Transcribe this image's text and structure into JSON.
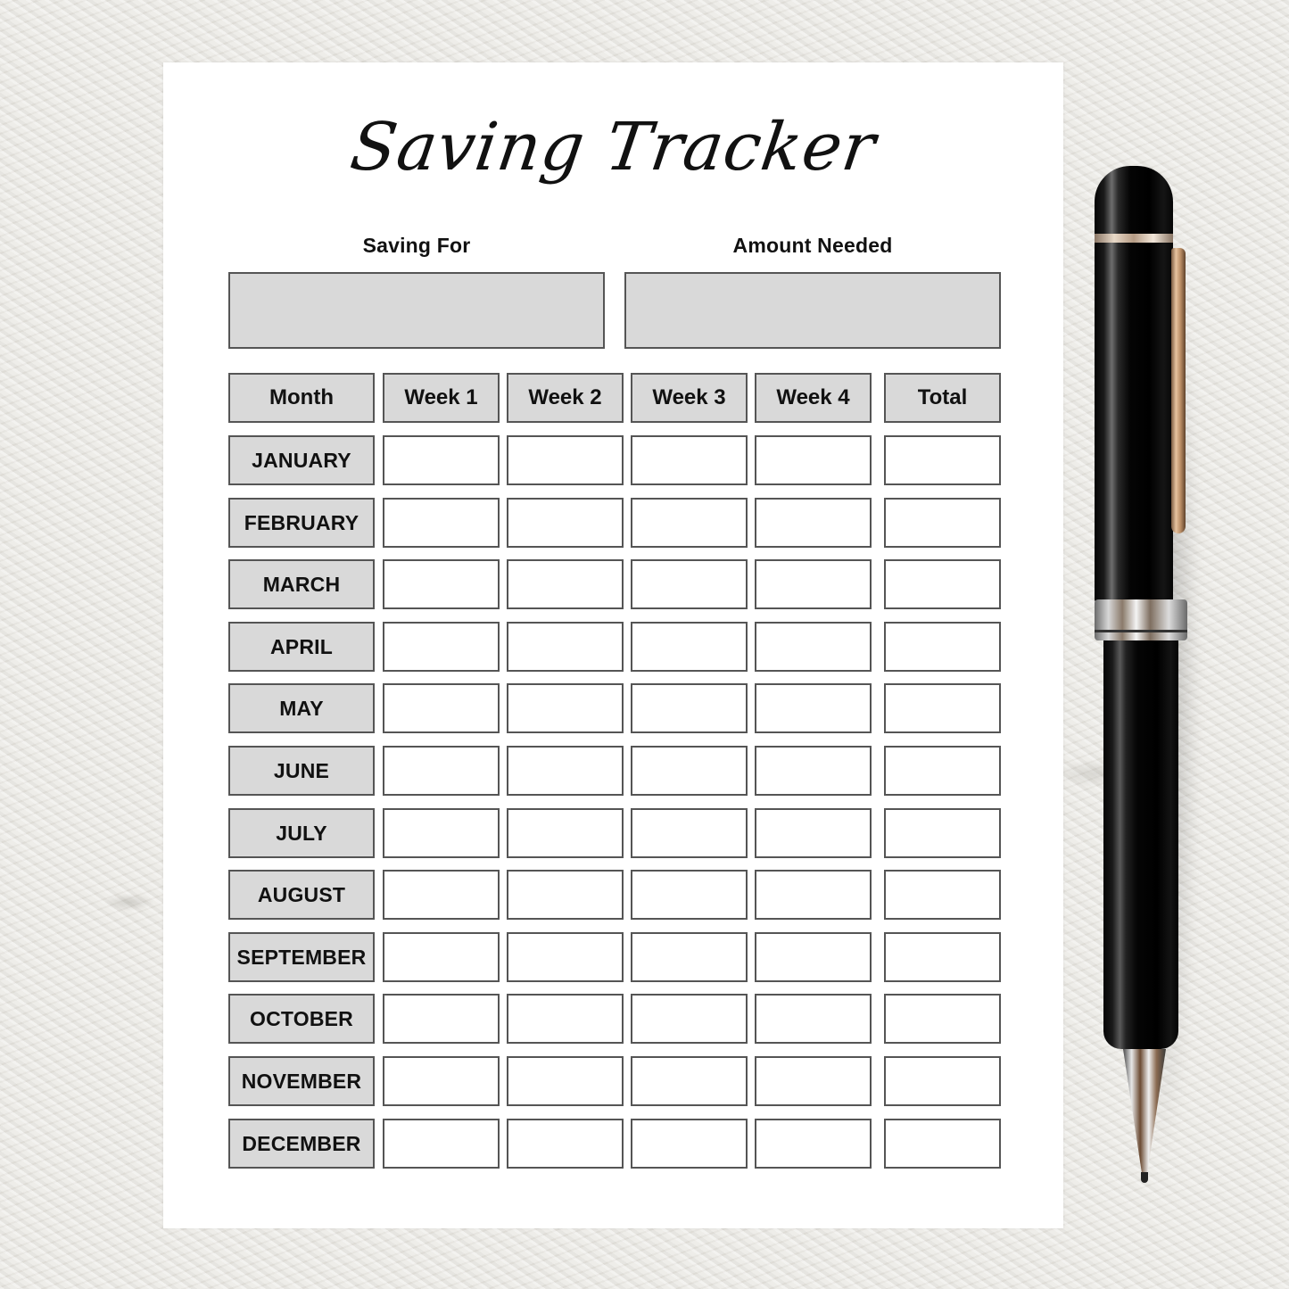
{
  "title": "Saving Tracker",
  "fields": {
    "saving_for": {
      "label": "Saving For",
      "value": ""
    },
    "amount_needed": {
      "label": "Amount Needed",
      "value": ""
    }
  },
  "table": {
    "columns": [
      "Month",
      "Week 1",
      "Week 2",
      "Week 3",
      "Week 4",
      "Total"
    ],
    "rows": [
      {
        "month": "JANUARY",
        "week1": "",
        "week2": "",
        "week3": "",
        "week4": "",
        "total": ""
      },
      {
        "month": "FEBRUARY",
        "week1": "",
        "week2": "",
        "week3": "",
        "week4": "",
        "total": ""
      },
      {
        "month": "MARCH",
        "week1": "",
        "week2": "",
        "week3": "",
        "week4": "",
        "total": ""
      },
      {
        "month": "APRIL",
        "week1": "",
        "week2": "",
        "week3": "",
        "week4": "",
        "total": ""
      },
      {
        "month": "MAY",
        "week1": "",
        "week2": "",
        "week3": "",
        "week4": "",
        "total": ""
      },
      {
        "month": "JUNE",
        "week1": "",
        "week2": "",
        "week3": "",
        "week4": "",
        "total": ""
      },
      {
        "month": "JULY",
        "week1": "",
        "week2": "",
        "week3": "",
        "week4": "",
        "total": ""
      },
      {
        "month": "AUGUST",
        "week1": "",
        "week2": "",
        "week3": "",
        "week4": "",
        "total": ""
      },
      {
        "month": "SEPTEMBER",
        "week1": "",
        "week2": "",
        "week3": "",
        "week4": "",
        "total": ""
      },
      {
        "month": "OCTOBER",
        "week1": "",
        "week2": "",
        "week3": "",
        "week4": "",
        "total": ""
      },
      {
        "month": "NOVEMBER",
        "week1": "",
        "week2": "",
        "week3": "",
        "week4": "",
        "total": ""
      },
      {
        "month": "DECEMBER",
        "week1": "",
        "week2": "",
        "week3": "",
        "week4": "",
        "total": ""
      }
    ]
  },
  "colors": {
    "header_fill": "#d9d9d9",
    "border": "#555555",
    "paper": "#ffffff"
  },
  "decor": {
    "background": "textured-paper-surface",
    "pen": "black-ballpoint-pen-icon"
  }
}
